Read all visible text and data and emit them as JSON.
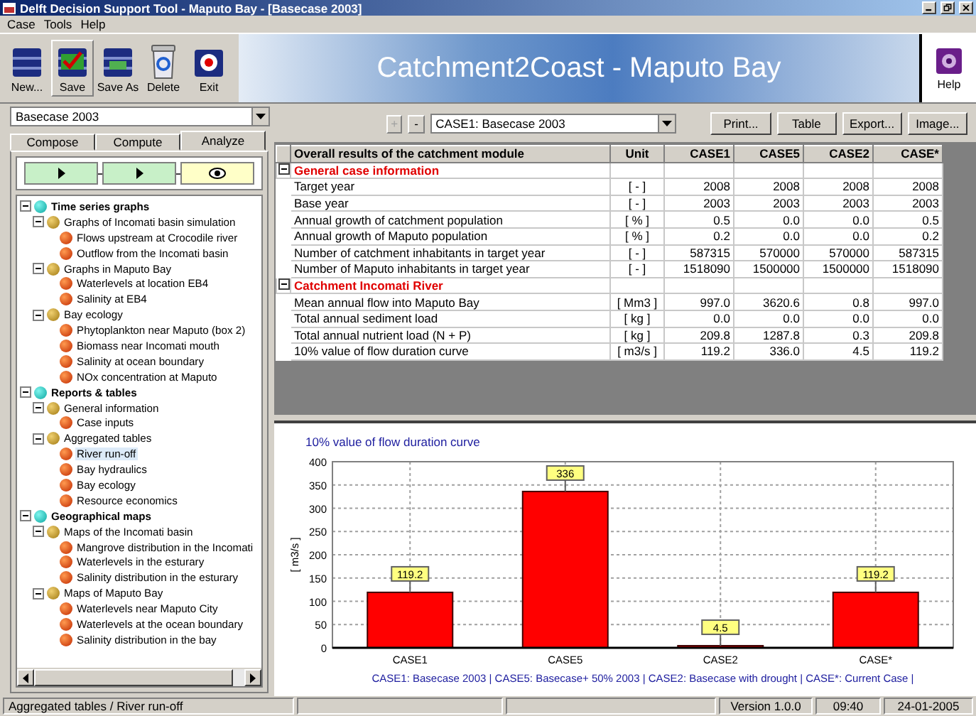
{
  "window": {
    "title": "Delft Decision Support Tool - Maputo Bay - [Basecase 2003]"
  },
  "menu": [
    "Case",
    "Tools",
    "Help"
  ],
  "toolbar": [
    {
      "label": "New...",
      "kind": "new",
      "selected": false
    },
    {
      "label": "Save",
      "kind": "save",
      "selected": true
    },
    {
      "label": "Save As",
      "kind": "saveas",
      "selected": false
    },
    {
      "label": "Delete",
      "kind": "delete",
      "selected": false
    },
    {
      "label": "Exit",
      "kind": "exit",
      "selected": false
    }
  ],
  "banner": "Catchment2Coast - Maputo Bay",
  "help_button": "Help",
  "case_combo": {
    "value": "Basecase 2003"
  },
  "tabs": [
    {
      "label": "Compose",
      "selected": false
    },
    {
      "label": "Compute",
      "selected": false
    },
    {
      "label": "Analyze",
      "selected": true
    }
  ],
  "steps": [
    {
      "kind": "play",
      "selected": false
    },
    {
      "kind": "play",
      "selected": false
    },
    {
      "kind": "eye",
      "selected": true
    }
  ],
  "tree": [
    {
      "label": "Time series graphs",
      "kind": "category",
      "expanded": true,
      "selected": false,
      "children": [
        {
          "label": "Graphs of Incomati basin simulation",
          "kind": "group",
          "expanded": true,
          "selected": false,
          "children": [
            {
              "label": "Flows upstream at Crocodile river",
              "kind": "item",
              "selected": false
            },
            {
              "label": "Outflow from the Incomati basin",
              "kind": "item",
              "selected": false
            }
          ]
        },
        {
          "label": "Graphs in Maputo Bay",
          "kind": "group",
          "expanded": true,
          "selected": false,
          "children": [
            {
              "label": "Waterlevels at location EB4",
              "kind": "item",
              "selected": false
            },
            {
              "label": "Salinity at EB4",
              "kind": "item",
              "selected": false
            }
          ]
        },
        {
          "label": "Bay ecology",
          "kind": "group",
          "expanded": true,
          "selected": false,
          "children": [
            {
              "label": "Phytoplankton near Maputo (box 2)",
              "kind": "item",
              "selected": false
            },
            {
              "label": "Biomass near Incomati mouth",
              "kind": "item",
              "selected": false
            },
            {
              "label": "Salinity at ocean boundary",
              "kind": "item",
              "selected": false
            },
            {
              "label": "NOx concentration at Maputo",
              "kind": "item",
              "selected": false
            }
          ]
        }
      ]
    },
    {
      "label": "Reports & tables",
      "kind": "category",
      "expanded": true,
      "selected": false,
      "children": [
        {
          "label": "General information",
          "kind": "group",
          "expanded": true,
          "selected": false,
          "children": [
            {
              "label": "Case inputs",
              "kind": "item",
              "selected": false
            }
          ]
        },
        {
          "label": "Aggregated tables",
          "kind": "group",
          "expanded": true,
          "selected": false,
          "children": [
            {
              "label": "River run-off",
              "kind": "item",
              "selected": true
            },
            {
              "label": "Bay hydraulics",
              "kind": "item",
              "selected": false
            },
            {
              "label": "Bay ecology",
              "kind": "item",
              "selected": false
            },
            {
              "label": "Resource economics",
              "kind": "item",
              "selected": false
            }
          ]
        }
      ]
    },
    {
      "label": "Geographical maps",
      "kind": "category",
      "expanded": true,
      "selected": false,
      "children": [
        {
          "label": "Maps of the Incomati basin",
          "kind": "group",
          "expanded": true,
          "selected": false,
          "children": [
            {
              "label": "Mangrove distribution in the Incomati",
              "kind": "item",
              "selected": false
            },
            {
              "label": "Waterlevels in the esturary",
              "kind": "item",
              "selected": false
            },
            {
              "label": "Salinity distribution in the esturary",
              "kind": "item",
              "selected": false
            }
          ]
        },
        {
          "label": "Maps of Maputo Bay",
          "kind": "group",
          "expanded": true,
          "selected": false,
          "children": [
            {
              "label": "Waterlevels near Maputo City",
              "kind": "item",
              "selected": false
            },
            {
              "label": "Waterlevels at the ocean boundary",
              "kind": "item",
              "selected": false
            },
            {
              "label": "Salinity distribution in the bay",
              "kind": "item",
              "selected": false
            }
          ]
        }
      ]
    }
  ],
  "nav_buttons": [
    {
      "label": "+",
      "disabled": true
    },
    {
      "label": "-",
      "disabled": false
    }
  ],
  "case_select": {
    "value": "CASE1: Basecase 2003"
  },
  "action_buttons": [
    "Print...",
    "Table",
    "Export...",
    "Image..."
  ],
  "table": {
    "columns": [
      "Overall results of the catchment module",
      "Unit",
      "CASE1",
      "CASE5",
      "CASE2",
      "CASE*"
    ],
    "sections": [
      {
        "title": "General case information",
        "expanded": true,
        "rows": [
          [
            "Target year",
            "[ - ]",
            "2008",
            "2008",
            "2008",
            "2008"
          ],
          [
            "Base year",
            "[ - ]",
            "2003",
            "2003",
            "2003",
            "2003"
          ],
          [
            "Annual growth of catchment population",
            "[ % ]",
            "0.5",
            "0.0",
            "0.0",
            "0.5"
          ],
          [
            "Annual growth of Maputo population",
            "[ % ]",
            "0.2",
            "0.0",
            "0.0",
            "0.2"
          ],
          [
            "Number of catchment inhabitants in target year",
            "[ - ]",
            "587315",
            "570000",
            "570000",
            "587315"
          ],
          [
            "Number of Maputo inhabitants in target year",
            "[ - ]",
            "1518090",
            "1500000",
            "1500000",
            "1518090"
          ]
        ]
      },
      {
        "title": "Catchment Incomati River",
        "expanded": true,
        "rows": [
          [
            "Mean annual flow into Maputo Bay",
            "[ Mm3 ]",
            "997.0",
            "3620.6",
            "0.8",
            "997.0"
          ],
          [
            "Total annual sediment load",
            "[ kg ]",
            "0.0",
            "0.0",
            "0.0",
            "0.0"
          ],
          [
            "Total annual nutrient load (N + P)",
            "[ kg ]",
            "209.8",
            "1287.8",
            "0.3",
            "209.8"
          ],
          [
            "10% value of flow duration curve",
            "[ m3/s ]",
            "119.2",
            "336.0",
            "4.5",
            "119.2"
          ]
        ]
      }
    ]
  },
  "chart": {
    "chart_data": {
      "type": "bar",
      "title": "10% value of flow duration curve",
      "ylabel": "[ m3/s ]",
      "categories": [
        "CASE1",
        "CASE5",
        "CASE2",
        "CASE*"
      ],
      "grid": true,
      "series": [
        {
          "color": "#ff0000",
          "values": [
            119.2,
            336.0,
            4.5,
            119.2
          ]
        }
      ],
      "ylim": [
        0,
        400
      ],
      "yticks": [
        0,
        50,
        100,
        150,
        200,
        250,
        300,
        350,
        400
      ],
      "value_labels": [
        "119.2",
        "336",
        "4.5",
        "119.2"
      ]
    },
    "legend": "CASE1: Basecase 2003 | CASE5: Basecase+ 50% 2003 | CASE2: Basecase with drought | CASE*: Current Case |"
  },
  "status_bar": {
    "path": "Aggregated tables / River run-off",
    "version": "Version 1.0.0",
    "time": "09:40",
    "date": "24-01-2005"
  }
}
